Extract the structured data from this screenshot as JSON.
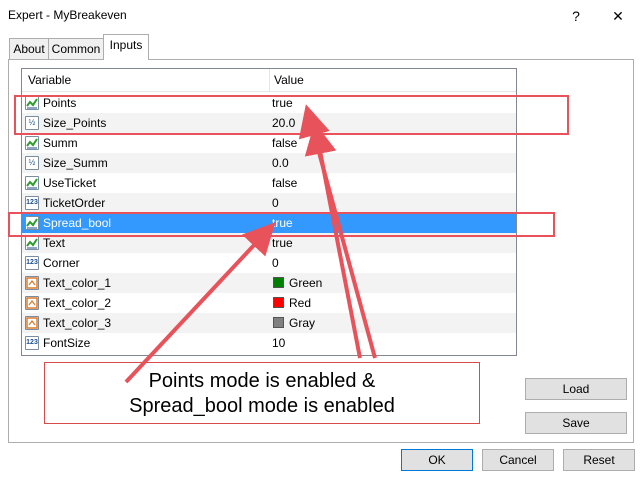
{
  "window": {
    "title": "Expert - MyBreakeven",
    "help_glyph": "?",
    "close_glyph": "✕"
  },
  "tabs": [
    {
      "label": "About"
    },
    {
      "label": "Common"
    },
    {
      "label": "Inputs"
    }
  ],
  "table": {
    "columns": [
      "Variable",
      "Value"
    ],
    "rows": [
      {
        "icon": "bool-icon",
        "name": "Points",
        "value": "true"
      },
      {
        "icon": "double-icon",
        "name": "Size_Points",
        "value": "20.0"
      },
      {
        "icon": "bool-icon",
        "name": "Summ",
        "value": "false"
      },
      {
        "icon": "double-icon",
        "name": "Size_Summ",
        "value": "0.0"
      },
      {
        "icon": "bool-icon",
        "name": "UseTicket",
        "value": "false"
      },
      {
        "icon": "int-icon",
        "name": "TicketOrder",
        "value": "0"
      },
      {
        "icon": "bool-icon",
        "name": "Spread_bool",
        "value": "true",
        "selected": true
      },
      {
        "icon": "bool-icon",
        "name": "Text",
        "value": "true"
      },
      {
        "icon": "int-icon",
        "name": "Corner",
        "value": "0"
      },
      {
        "icon": "color-icon",
        "name": "Text_color_1",
        "value": "Green",
        "swatch": "#008000"
      },
      {
        "icon": "color-icon",
        "name": "Text_color_2",
        "value": "Red",
        "swatch": "#ff0000"
      },
      {
        "icon": "color-icon",
        "name": "Text_color_3",
        "value": "Gray",
        "swatch": "#808080"
      },
      {
        "icon": "int-icon",
        "name": "FontSize",
        "value": "10"
      }
    ]
  },
  "icon_text": {
    "int": "123",
    "double": "½"
  },
  "side_buttons": {
    "load": "Load",
    "save": "Save"
  },
  "bottom_buttons": {
    "ok": "OK",
    "cancel": "Cancel",
    "reset": "Reset"
  },
  "annotation": {
    "line1": "Points mode is enabled &",
    "line2": "Spread_bool mode is enabled"
  },
  "colors": {
    "selection": "#3399ff",
    "annotation_red": "#e8525a"
  }
}
